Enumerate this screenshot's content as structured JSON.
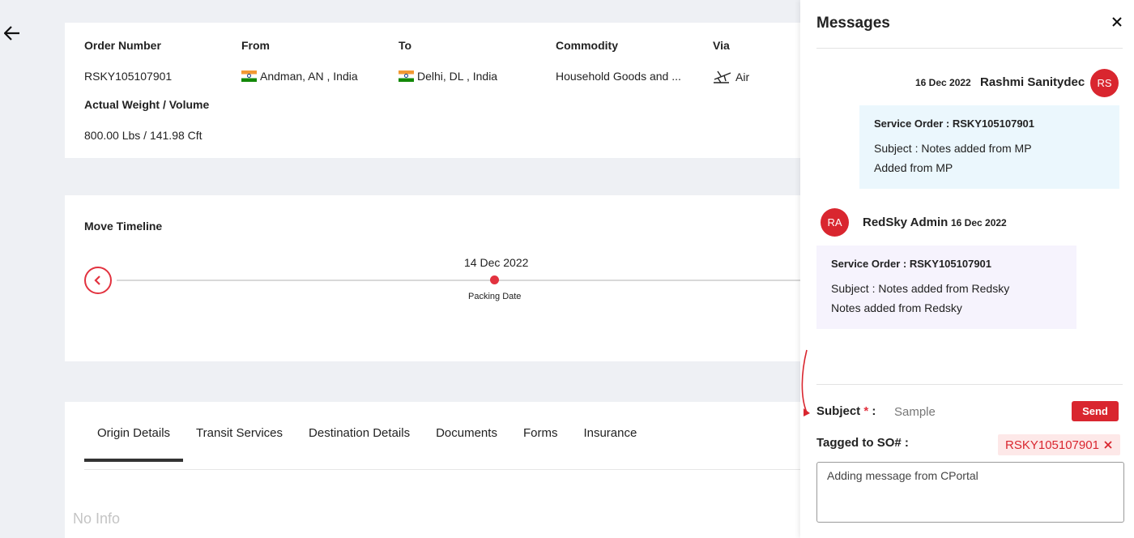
{
  "order": {
    "number_label": "Order Number",
    "number_value": "RSKY105107901",
    "from_label": "From",
    "from_value": "Andman, AN , India",
    "to_label": "To",
    "to_value": "Delhi, DL , India",
    "commodity_label": "Commodity",
    "commodity_value": "Household Goods and ...",
    "via_label": "Via",
    "via_value": "Air",
    "weight_label": "Actual Weight / Volume",
    "weight_value": "800.00 Lbs / 141.98 Cft"
  },
  "timeline": {
    "title": "Move Timeline",
    "events": [
      {
        "date": "14 Dec 2022",
        "caption": "Packing Date"
      }
    ]
  },
  "tabs": [
    {
      "label": "Origin Details",
      "active": true
    },
    {
      "label": "Transit Services"
    },
    {
      "label": "Destination Details"
    },
    {
      "label": "Documents"
    },
    {
      "label": "Forms"
    },
    {
      "label": "Insurance"
    }
  ],
  "no_info": "No Info",
  "messages_panel": {
    "title": "Messages",
    "messages": [
      {
        "date": "16 Dec 2022",
        "author": "Rashmi Sanitydec",
        "initials": "RS",
        "so_line": "Service Order : RSKY105107901",
        "subject_line": "Subject : Notes added from MP",
        "body": "Added from MP"
      },
      {
        "date": "16 Dec 2022",
        "author": "RedSky Admin",
        "initials": "RA",
        "so_line": "Service Order : RSKY105107901",
        "subject_line": "Subject : Notes added from Redsky",
        "body": "Notes added from Redsky"
      }
    ],
    "compose": {
      "subject_label": "Subject",
      "subject_required": "*",
      "subject_colon": ":",
      "subject_value": "Sample",
      "send_label": "Send",
      "tagged_label": "Tagged to SO# :",
      "tag": "RSKY105107901",
      "message_value": "Adding message from CPortal"
    }
  },
  "colors": {
    "accent": "#d9262f",
    "background": "#eef0f4",
    "right_bubble": "#ebf7fd",
    "left_bubble": "#f6f3fd"
  }
}
